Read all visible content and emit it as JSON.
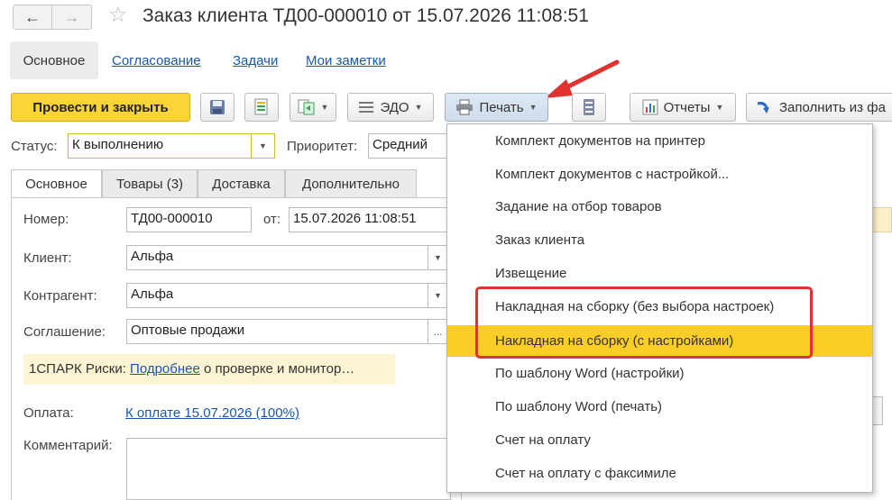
{
  "header": {
    "back_icon": "←",
    "forward_icon": "→",
    "star_icon": "☆",
    "title": "Заказ клиента ТД00-000010 от 15.07.2026 11:08:51"
  },
  "sections": {
    "active": "Основное",
    "links": [
      "Согласование",
      "Задачи",
      "Мои заметки"
    ]
  },
  "toolbar": {
    "post_close": "Провести и закрыть",
    "edo": "ЭДО",
    "print": "Печать",
    "reports": "Отчеты",
    "fill": "Заполнить из фа"
  },
  "status": {
    "label": "Статус:",
    "value": "К выполнению",
    "priority_label": "Приоритет:",
    "priority_value": "Средний"
  },
  "tabs": [
    "Основное",
    "Товары (3)",
    "Доставка",
    "Дополнительно"
  ],
  "form": {
    "number_label": "Номер:",
    "number_value": "ТД00-000010",
    "date_label": "от:",
    "date_value": "15.07.2026 11:08:51",
    "client_label": "Клиент:",
    "client_value": "Альфа",
    "contractor_label": "Контрагент:",
    "contractor_value": "Альфа",
    "agreement_label": "Соглашение:",
    "agreement_value": "Оптовые продажи",
    "spark_prefix": "1СПАРК Риски:",
    "spark_link": "Подробнее",
    "spark_suffix": "о проверке и монитор…",
    "payment_label": "Оплата:",
    "payment_link": "К оплате 15.07.2026 (100%)",
    "comment_label": "Комментарий:"
  },
  "print_menu": {
    "items": [
      "Комплект документов на принтер",
      "Комплект документов с настройкой...",
      "Задание на отбор товаров",
      "Заказ клиента",
      "Извещение",
      "Накладная на сборку (без выбора настроек)",
      "Накладная на сборку (с настройками)",
      "По шаблону Word (настройки)",
      "По шаблону Word (печать)",
      "Счет на оплату",
      "Счет на оплату с факсимиле"
    ],
    "selected_index": 6
  },
  "colors": {
    "accent_yellow": "#fbd535",
    "selection": "#fbcd27",
    "link": "#1a57b3",
    "annotation_red": "#e0322e"
  }
}
